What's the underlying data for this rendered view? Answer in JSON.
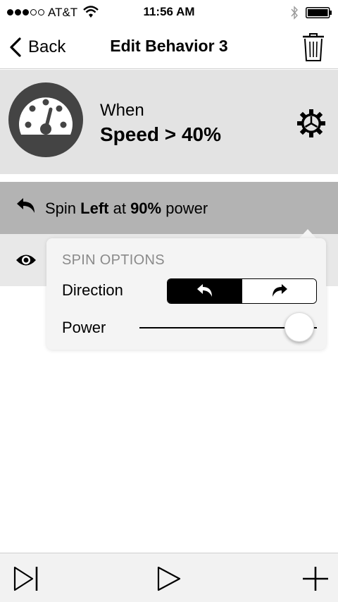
{
  "status_bar": {
    "carrier": "AT&T",
    "time": "11:56 AM",
    "signal_filled": 3,
    "signal_total": 5
  },
  "nav": {
    "back_label": "Back",
    "title": "Edit Behavior 3",
    "back_icon": "chevron-left-icon",
    "trash_icon": "trash-icon"
  },
  "trigger": {
    "icon": "speedometer-icon",
    "when_label": "When",
    "condition": "Speed > 40%",
    "settings_icon": "gear-icon"
  },
  "action": {
    "icon": "turn-left-arrow-icon",
    "text_prefix": "Spin ",
    "direction": "Left",
    "text_middle": " at ",
    "power": "90%",
    "text_suffix": " power"
  },
  "second_row": {
    "icon": "eye-icon"
  },
  "popover": {
    "header": "SPIN OPTIONS",
    "direction_label": "Direction",
    "direction_options": [
      "left",
      "right"
    ],
    "direction_selected": "left",
    "power_label": "Power",
    "power_value": 0.9
  },
  "toolbar": {
    "step_icon": "step-forward-icon",
    "play_icon": "play-icon",
    "add_icon": "plus-icon"
  },
  "colors": {
    "trigger_bg": "#e3e3e3",
    "action_bg": "#b3b3b3",
    "gauge_fill": "#444444"
  }
}
